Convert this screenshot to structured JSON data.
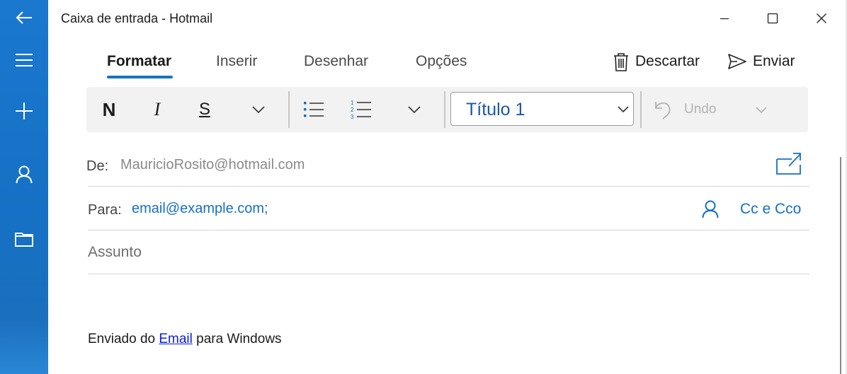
{
  "window": {
    "title": "Caixa de entrada - Hotmail"
  },
  "rail": {
    "items": [
      "back-icon",
      "menu-icon",
      "new-mail-icon",
      "account-icon",
      "folder-icon"
    ]
  },
  "tabs": [
    {
      "label": "Formatar",
      "active": true
    },
    {
      "label": "Inserir",
      "active": false
    },
    {
      "label": "Desenhar",
      "active": false
    },
    {
      "label": "Opções",
      "active": false
    }
  ],
  "actions": {
    "discard_label": "Descartar",
    "send_label": "Enviar"
  },
  "toolbar": {
    "bold": "N",
    "italic": "I",
    "underline": "S",
    "style_value": "Título 1",
    "undo_label": "Undo"
  },
  "compose": {
    "from_label": "De:",
    "from_value": "MauricioRosito@hotmail.com",
    "to_label": "Para:",
    "to_value": "email@example.com;",
    "cc_label": "Cc e Cco",
    "subject_placeholder": "Assunto"
  },
  "body": {
    "signature_prefix": "Enviado do ",
    "signature_link": "Email",
    "signature_suffix": " para Windows"
  },
  "colors": {
    "accent": "#1474c4",
    "rail": "#1a78cf",
    "link": "#0b1fd6"
  }
}
